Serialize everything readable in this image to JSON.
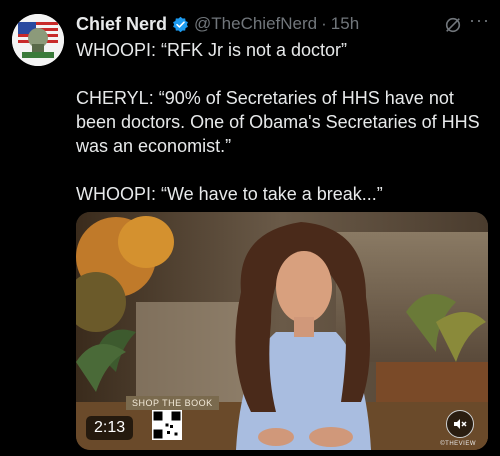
{
  "tweet": {
    "display_name": "Chief Nerd",
    "handle": "@TheChiefNerd",
    "separator": "·",
    "time": "15h",
    "more_label": "···",
    "lines": [
      "WHOOPI: “RFK Jr is not a doctor”",
      "",
      "CHERYL: “90% of Secretaries of HHS have not been doctors. One of Obama's Secretaries of HHS was an economist.”",
      "",
      "WHOOPI: “We have to take a break...”"
    ]
  },
  "video": {
    "duration": "2:13",
    "overlay_text": "SHOP THE BOOK",
    "watermark": "©THEVIEW"
  },
  "colors": {
    "background": "#000000",
    "text": "#e7e9ea",
    "secondary": "#71767b",
    "verified": "#1d9bf0"
  }
}
